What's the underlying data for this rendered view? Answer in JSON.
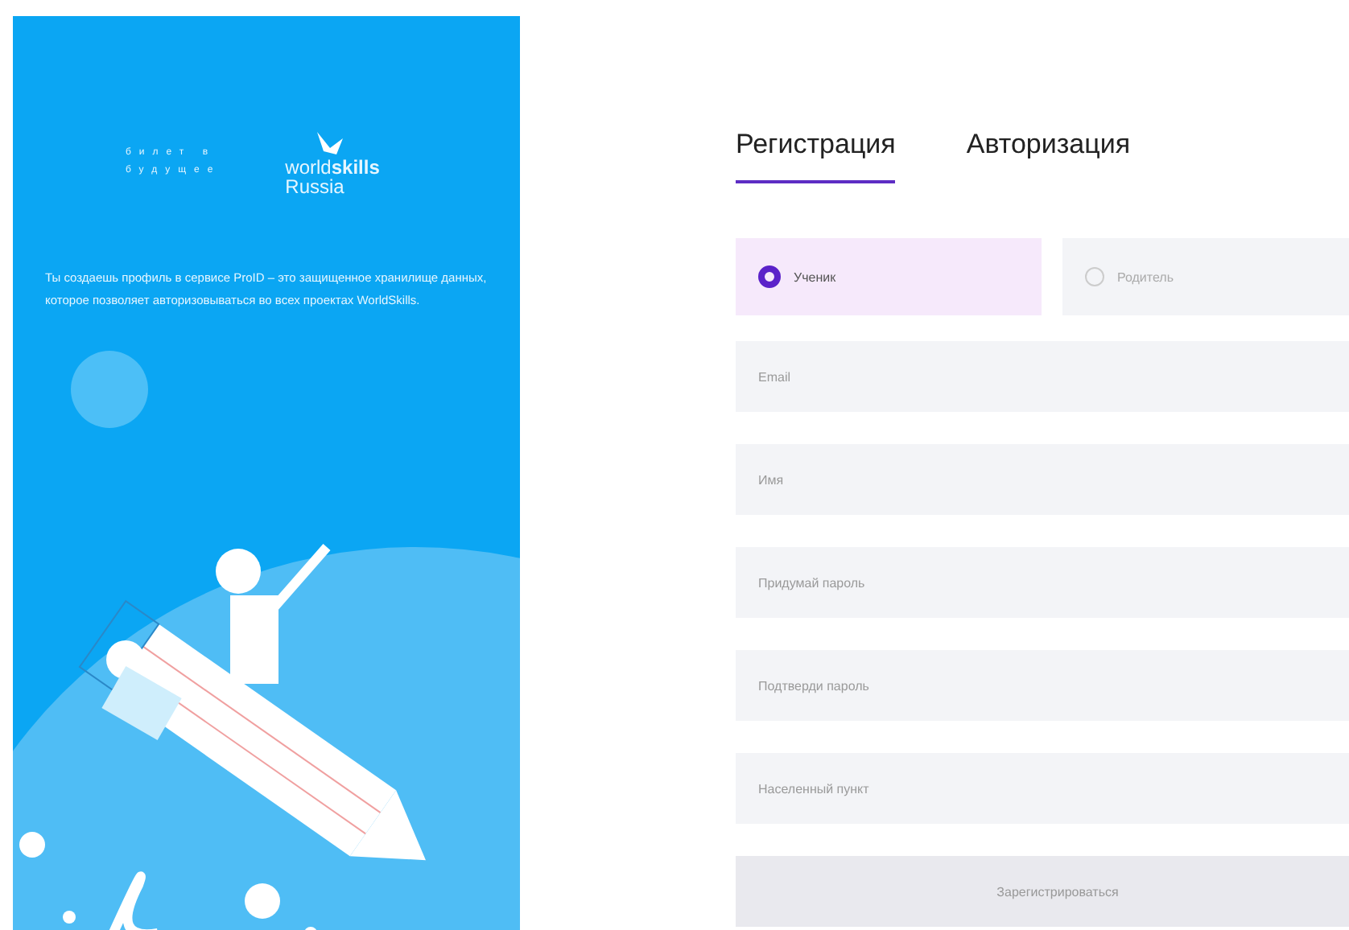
{
  "promo": {
    "logo_left": [
      "билет в",
      "будущее"
    ],
    "logo_right": {
      "prefix": "world",
      "brand": "skills",
      "region": "Russia"
    },
    "text": "Ты создаешь профиль в сервисе ProID – это защищенное хранилище данных, которое позволяет авторизовываться во всех проектах WorldSkills."
  },
  "tabs": [
    {
      "label": "Регистрация",
      "selected": true
    },
    {
      "label": "Авторизация",
      "selected": false
    }
  ],
  "roles": [
    {
      "label": "Ученик",
      "selected": true
    },
    {
      "label": "Родитель",
      "selected": false
    }
  ],
  "fields": [
    {
      "placeholder": "Email"
    },
    {
      "placeholder": "Имя"
    },
    {
      "placeholder": "Придумай пароль"
    },
    {
      "placeholder": "Подтверди пароль"
    },
    {
      "placeholder": "Населенный пункт"
    }
  ],
  "submit": "Зарегистрироваться"
}
